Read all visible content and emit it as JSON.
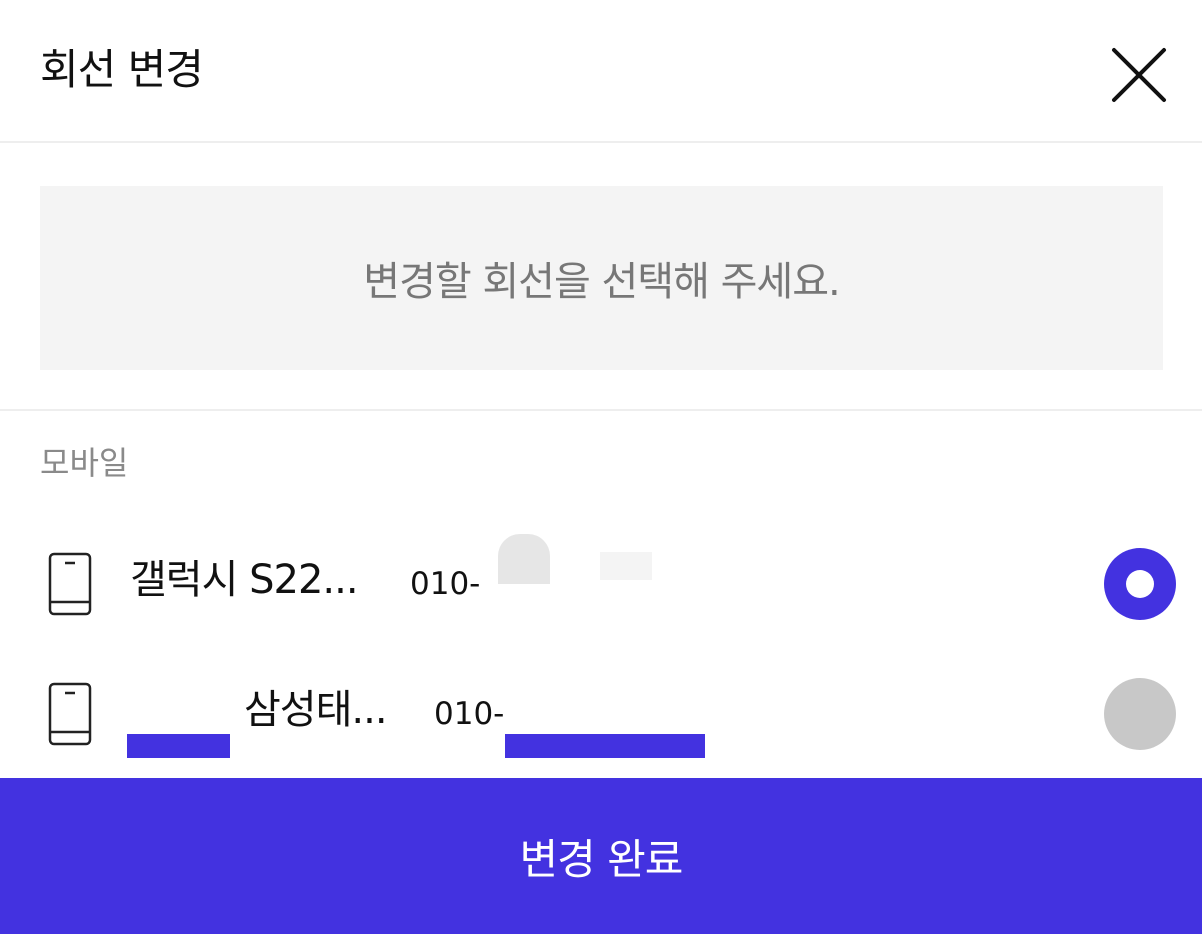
{
  "header": {
    "title": "회선 변경",
    "close_icon": "close-icon"
  },
  "notice": {
    "text": "변경할 회선을 선택해 주세요."
  },
  "section": {
    "label": "모바일"
  },
  "lines": [
    {
      "name": "갤럭시 S22...",
      "number": "010-",
      "selected": true,
      "icon": "smartphone-icon"
    },
    {
      "name": "삼성태...",
      "number": "010-",
      "selected": false,
      "icon": "smartphone-icon"
    }
  ],
  "cta": {
    "label": "변경 완료"
  },
  "colors": {
    "accent": "#4332e0",
    "radio_off": "#c8c8c8",
    "notice_bg": "#f4f4f4",
    "muted_text": "#8a8a8a"
  }
}
